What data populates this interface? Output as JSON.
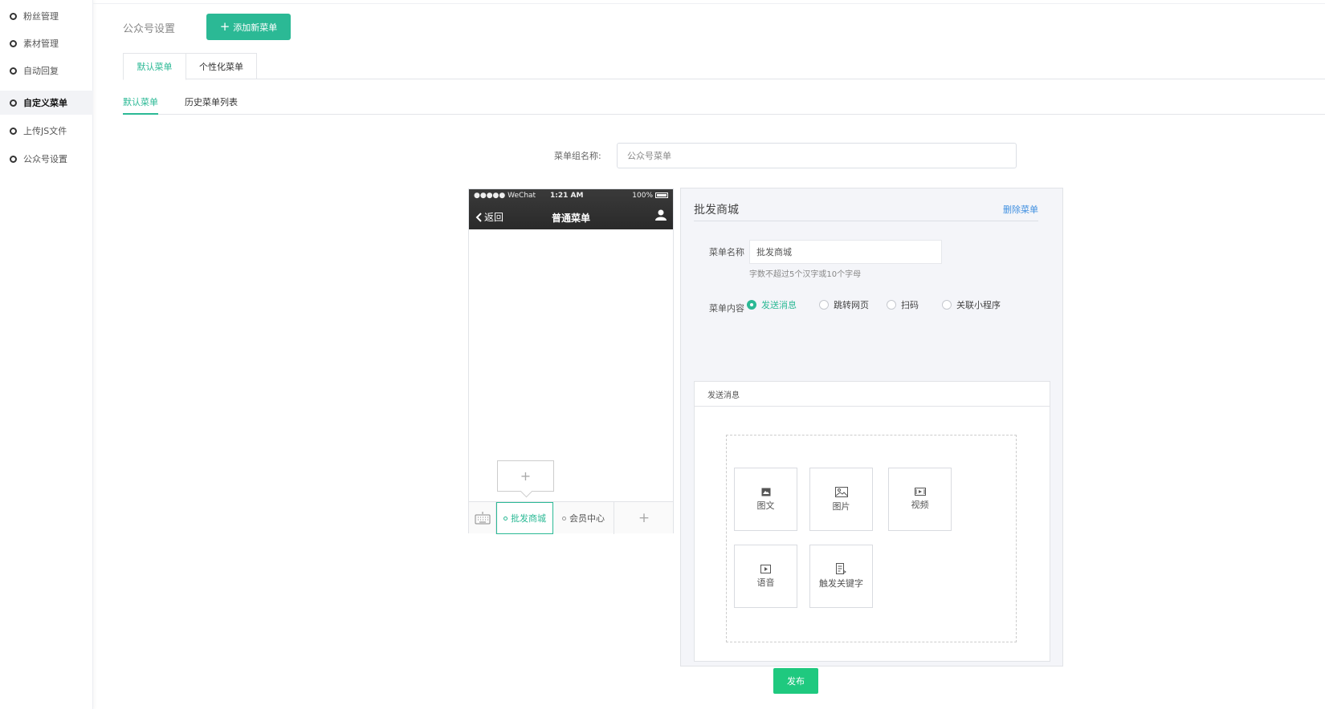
{
  "sidebar": {
    "items": [
      {
        "label": "粉丝管理",
        "active": false
      },
      {
        "label": "素材管理",
        "active": false
      },
      {
        "label": "自动回复",
        "active": false
      },
      {
        "label": "自定义菜单",
        "active": true
      },
      {
        "label": "上传JS文件",
        "active": false
      },
      {
        "label": "公众号设置",
        "active": false
      }
    ]
  },
  "header": {
    "title": "公众号设置",
    "add_button": "添加新菜单"
  },
  "tabs": [
    "默认菜单",
    "个性化菜单"
  ],
  "subtabs": [
    "默认菜单",
    "历史菜单列表"
  ],
  "group_name": {
    "label": "菜单组名称:",
    "placeholder": "公众号菜单"
  },
  "phone": {
    "carrier": "●●●●● WeChat",
    "time": "1:21 AM",
    "battery": "100%",
    "back": "返回",
    "title": "普通菜单",
    "add_submenu": "+",
    "menus": [
      "批发商城",
      "会员中心"
    ],
    "add_menu": "+"
  },
  "editor": {
    "title": "批发商城",
    "delete": "删除菜单",
    "name_label": "菜单名称",
    "name_value": "批发商城",
    "name_hint": "字数不超过5个汉字或10个字母",
    "content_label": "菜单内容",
    "options": [
      {
        "label": "发送消息",
        "checked": true
      },
      {
        "label": "跳转网页",
        "checked": false
      },
      {
        "label": "扫码",
        "checked": false
      },
      {
        "label": "关联小程序",
        "checked": false
      }
    ],
    "message_box_title": "发送消息",
    "message_types": [
      "图文",
      "图片",
      "视频",
      "语音",
      "触发关键字"
    ]
  },
  "publish": "发布",
  "colors": {
    "accent": "#2bb995",
    "publish": "#1fc97f",
    "link": "#3f8fe0"
  }
}
